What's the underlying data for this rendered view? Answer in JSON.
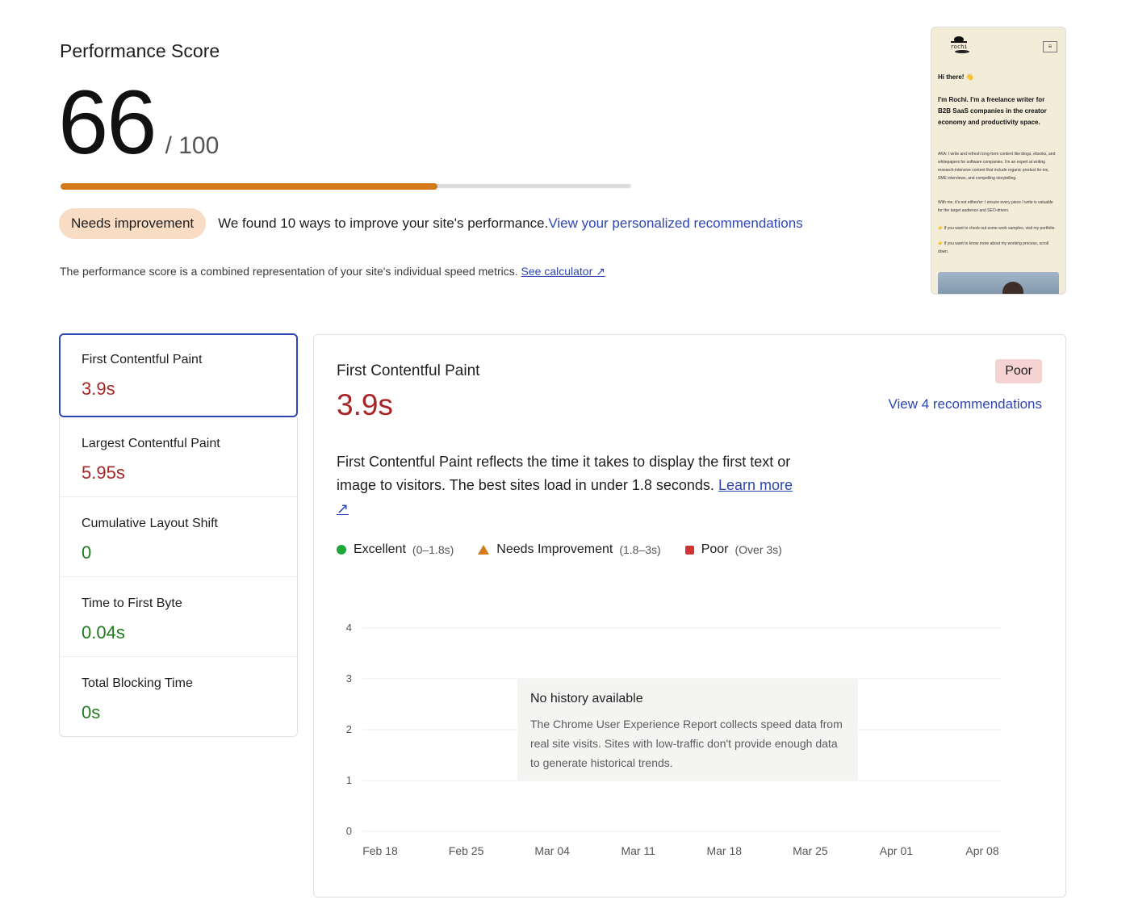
{
  "header": {
    "title": "Performance Score",
    "score": "66",
    "max": "/ 100",
    "score_fraction": 0.66,
    "bar_color": "#d57a1a",
    "badge": "Needs improvement",
    "summary": "We found 10 ways to improve your site's performance.",
    "recommendations_link": "View your personalized recommendations",
    "note": "The performance score is a combined representation of your site's individual speed metrics.",
    "calculator_link": "See calculator ↗"
  },
  "thumbnail": {
    "logo_text": "rochi",
    "greeting": "Hi there! 👋",
    "intro": "I'm Rochi. I'm a freelance writer for B2B SaaS companies in the creator economy and productivity space.",
    "para1": "AKA: I write and refresh long-form content like blogs, ebooks, and whitepapers for software companies. I'm an expert at writing research-intensive content that include organic product tie-ins, SME interviews, and compelling storytelling.",
    "para2": "With me, it's not either/or: I ensure every piece I write is valuable for the target audience and SEO-driven.",
    "para3": "👉 If you want to check out some work samples, visit my portfolio.",
    "para4": "👉 If you want to know more about my working process, scroll down."
  },
  "metrics": [
    {
      "name": "First Contentful Paint",
      "value": "3.9s",
      "status": "poor"
    },
    {
      "name": "Largest Contentful Paint",
      "value": "5.95s",
      "status": "poor"
    },
    {
      "name": "Cumulative Layout Shift",
      "value": "0",
      "status": "good"
    },
    {
      "name": "Time to First Byte",
      "value": "0.04s",
      "status": "good"
    },
    {
      "name": "Total Blocking Time",
      "value": "0s",
      "status": "good"
    }
  ],
  "detail": {
    "title": "First Contentful Paint",
    "value": "3.9s",
    "badge": "Poor",
    "recs_link": "View 4 recommendations",
    "description": "First Contentful Paint reflects the time it takes to display the first text or image to visitors. The best sites load in under 1.8 seconds.",
    "learn_more": "Learn more ↗",
    "legend": [
      {
        "label": "Excellent",
        "range": "(0–1.8s)",
        "icon": "circle-icon",
        "color": "#1fa83a"
      },
      {
        "label": "Needs Improvement",
        "range": "(1.8–3s)",
        "icon": "triangle-icon",
        "color": "#d57a1a"
      },
      {
        "label": "Poor",
        "range": "(Over 3s)",
        "icon": "square-icon",
        "color": "#d23333"
      }
    ],
    "no_history_title": "No history available",
    "no_history_body": "The Chrome User Experience Report collects speed data from real site visits. Sites with low-traffic don't provide enough data to generate historical trends."
  },
  "chart_data": {
    "type": "line",
    "x": [
      "Feb 18",
      "Feb 25",
      "Mar 04",
      "Mar 11",
      "Mar 18",
      "Mar 25",
      "Apr 01",
      "Apr 08"
    ],
    "y_ticks": [
      "4",
      "3",
      "2",
      "1",
      "0"
    ],
    "ylim": [
      0,
      4
    ],
    "series": [],
    "grid": true
  },
  "colors": {
    "accent": "#2d46b3",
    "poor": "#a92525",
    "good": "#1f7a1f"
  }
}
